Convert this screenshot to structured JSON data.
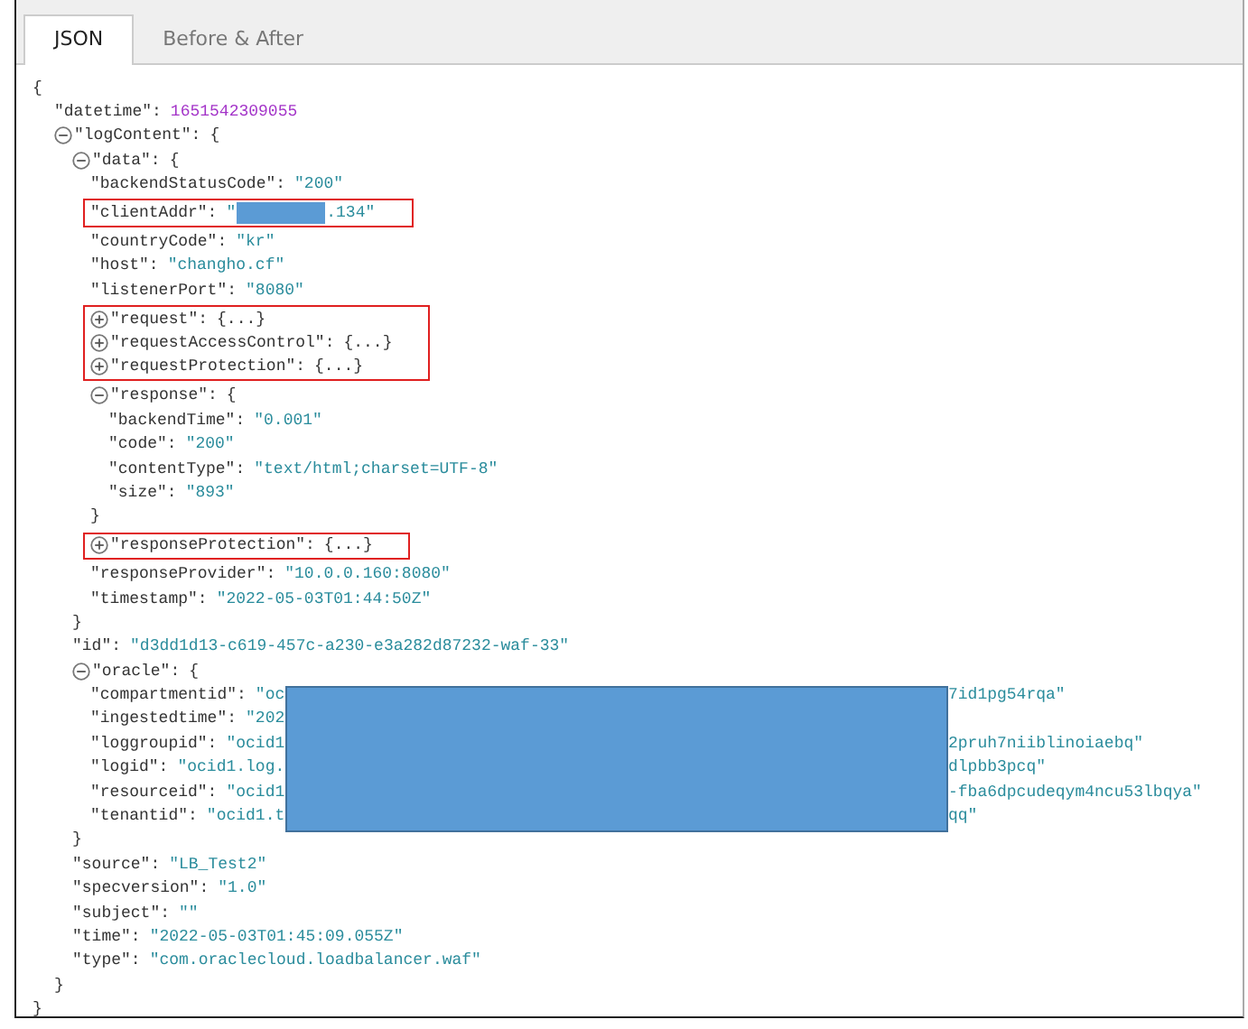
{
  "tabs": [
    {
      "label": "JSON",
      "selected": true
    },
    {
      "label": "Before & After",
      "selected": false
    }
  ],
  "tree": {
    "kind": "object",
    "open": "{",
    "close": "}",
    "children": [
      {
        "kind": "number",
        "key": "\"datetime\":",
        "value": "1651542309055"
      },
      {
        "kind": "object",
        "key": "\"logContent\":",
        "expanded": true,
        "open": "{",
        "close": "}",
        "children": [
          {
            "kind": "object",
            "key": "\"data\":",
            "expanded": true,
            "open": "{",
            "close": "}",
            "children": [
              {
                "kind": "string",
                "key": "\"backendStatusCode\":",
                "value": "\"200\""
              },
              {
                "kind": "masked_inline",
                "key": "\"clientAddr\":",
                "prefix": "\"",
                "suffix": ".134\"",
                "highlighted": true
              },
              {
                "kind": "string",
                "key": "\"countryCode\":",
                "value": "\"kr\""
              },
              {
                "kind": "string",
                "key": "\"host\":",
                "value": "\"changho.cf\""
              },
              {
                "kind": "string",
                "key": "\"listenerPort\":",
                "value": "\"8080\""
              },
              {
                "kind": "object",
                "key": "\"request\":",
                "expanded": false,
                "collapsed_text": "{...}",
                "highlighted": true
              },
              {
                "kind": "object",
                "key": "\"requestAccessControl\":",
                "expanded": false,
                "collapsed_text": "{...}",
                "highlighted": true
              },
              {
                "kind": "object",
                "key": "\"requestProtection\":",
                "expanded": false,
                "collapsed_text": "{...}",
                "highlighted": true
              },
              {
                "kind": "object",
                "key": "\"response\":",
                "expanded": true,
                "open": "{",
                "close": "}",
                "children": [
                  {
                    "kind": "string",
                    "key": "\"backendTime\":",
                    "value": "\"0.001\""
                  },
                  {
                    "kind": "string",
                    "key": "\"code\":",
                    "value": "\"200\""
                  },
                  {
                    "kind": "string",
                    "key": "\"contentType\":",
                    "value": "\"text/html;charset=UTF-8\""
                  },
                  {
                    "kind": "string",
                    "key": "\"size\":",
                    "value": "\"893\""
                  }
                ]
              },
              {
                "kind": "object",
                "key": "\"responseProtection\":",
                "expanded": false,
                "collapsed_text": "{...}",
                "highlighted": true
              },
              {
                "kind": "string",
                "key": "\"responseProvider\":",
                "value": "\"10.0.0.160:8080\""
              },
              {
                "kind": "string",
                "key": "\"timestamp\":",
                "value": "\"2022-05-03T01:44:50Z\""
              }
            ]
          },
          {
            "kind": "string",
            "key": "\"id\":",
            "value": "\"d3dd1d13-c619-457c-a230-e3a282d87232-waf-33\""
          },
          {
            "kind": "object",
            "key": "\"oracle\":",
            "expanded": true,
            "open": "{",
            "close": "}",
            "redaction": true,
            "children": [
              {
                "kind": "masked_column",
                "key": "\"compartmentid\":",
                "prefix": "\"oc",
                "suffix": "7id1pg54rqa\""
              },
              {
                "kind": "masked_column",
                "key": "\"ingestedtime\":",
                "prefix": "\"202"
              },
              {
                "kind": "masked_column",
                "key": "\"loggroupid\":",
                "prefix": "\"ocid1",
                "suffix": "2pruh7niiblinoiaebq\""
              },
              {
                "kind": "masked_column",
                "key": "\"logid\":",
                "prefix": "\"ocid1.log.",
                "suffix": "dlpbb3pcq\""
              },
              {
                "kind": "masked_column",
                "key": "\"resourceid\":",
                "prefix": "\"ocid1",
                "suffix": "-fba6dpcudeqym4ncu53lbqya\""
              },
              {
                "kind": "masked_column",
                "key": "\"tenantid\":",
                "prefix": "\"ocid1.t",
                "suffix": "qq\""
              }
            ]
          },
          {
            "kind": "string",
            "key": "\"source\":",
            "value": "\"LB_Test2\""
          },
          {
            "kind": "string",
            "key": "\"specversion\":",
            "value": "\"1.0\""
          },
          {
            "kind": "string",
            "key": "\"subject\":",
            "value": "\"\""
          },
          {
            "kind": "string",
            "key": "\"time\":",
            "value": "\"2022-05-03T01:45:09.055Z\""
          },
          {
            "kind": "string",
            "key": "\"type\":",
            "value": "\"com.oraclecloud.loadbalancer.waf\""
          }
        ]
      }
    ]
  }
}
